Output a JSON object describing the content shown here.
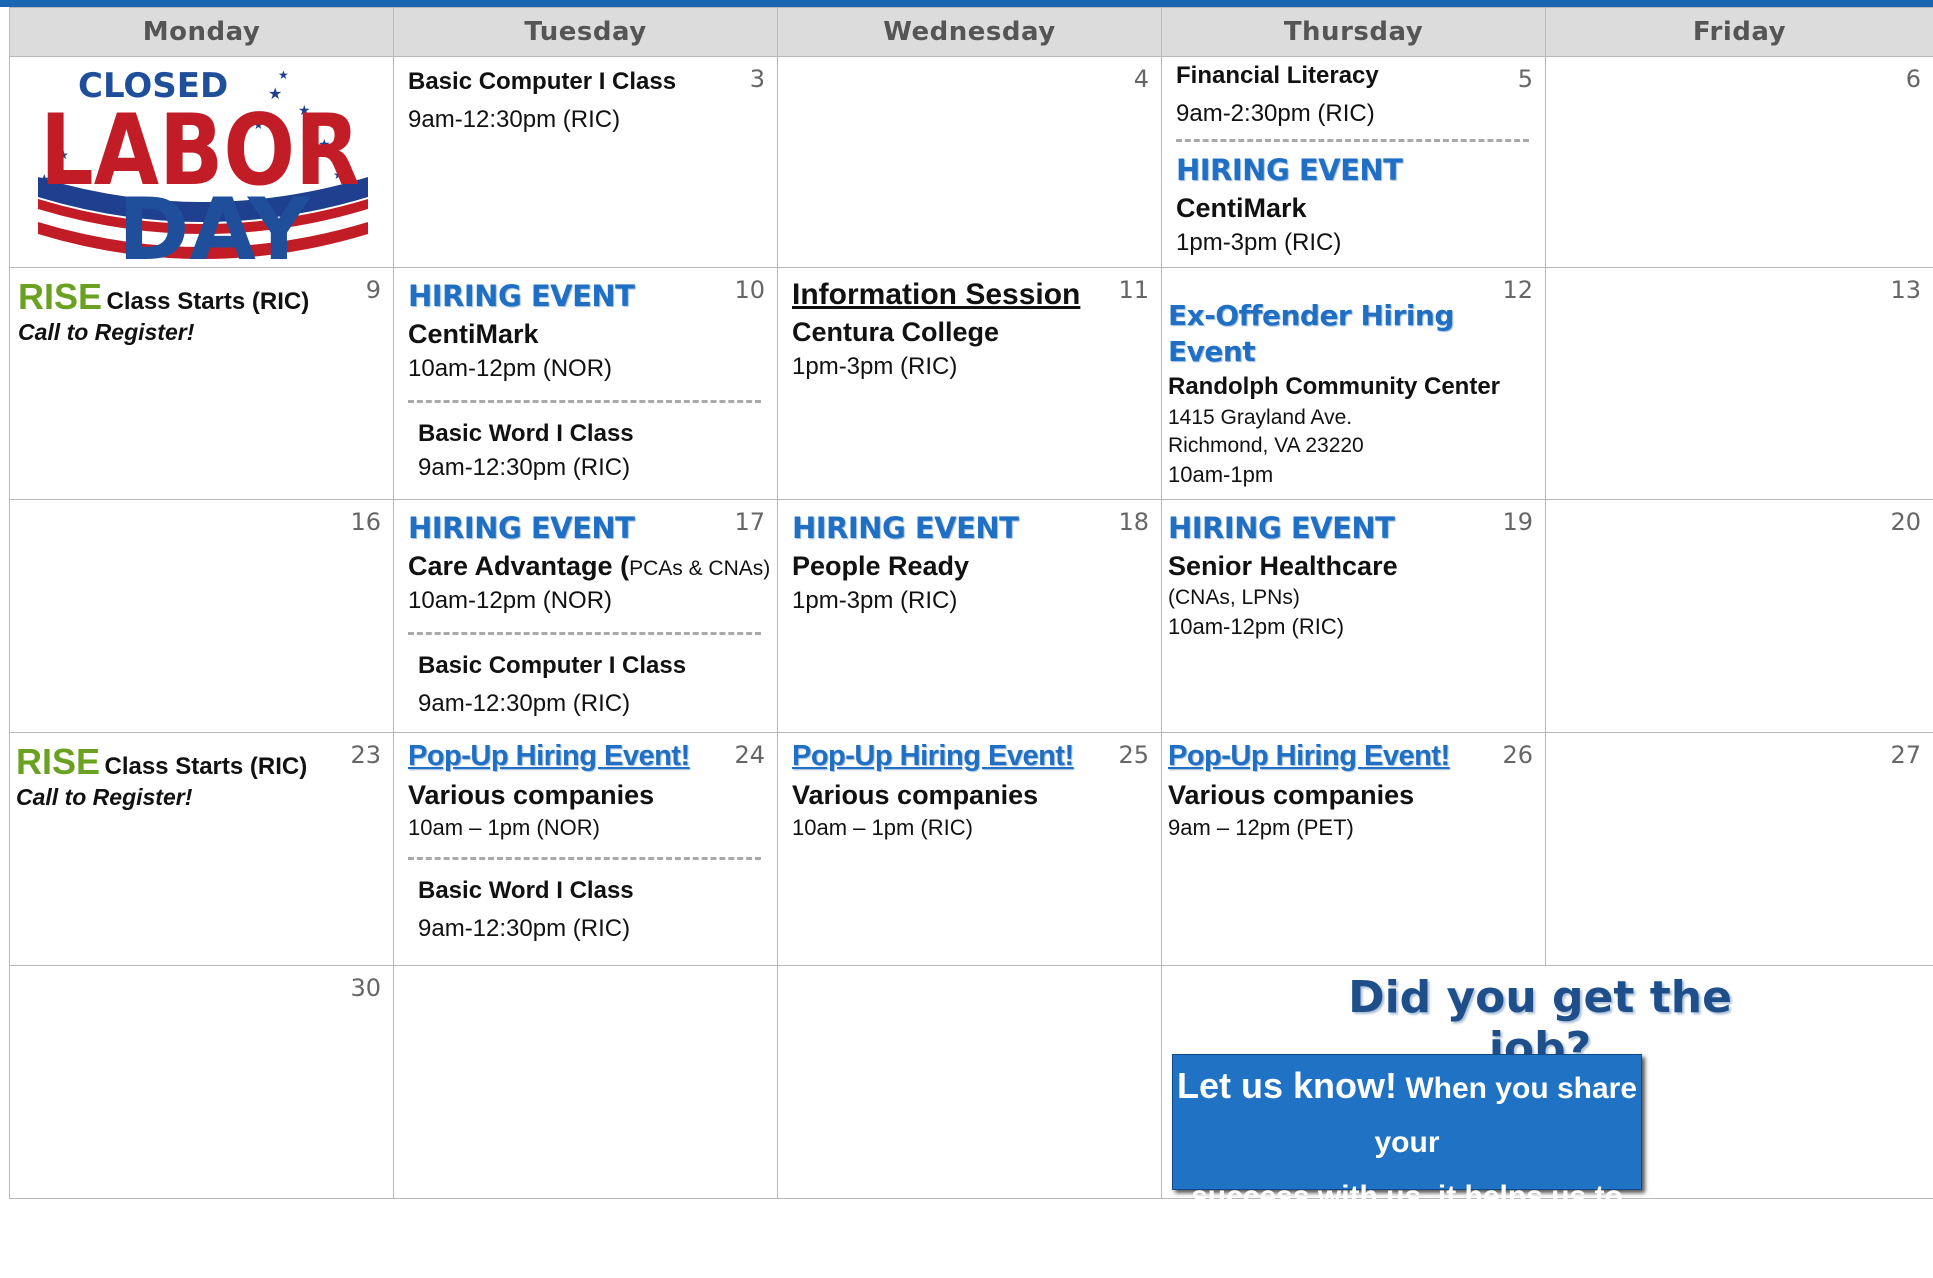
{
  "headers": [
    "Monday",
    "Tuesday",
    "Wednesday",
    "Thursday",
    "Friday"
  ],
  "week1": {
    "mon_logo": {
      "closed": "CLOSED",
      "labor": "LABOR",
      "day": "DAY"
    },
    "tue": {
      "day": "3",
      "title": "Basic Computer I Class",
      "time": "9am-12:30pm (RIC)"
    },
    "wed": {
      "day": "4"
    },
    "thu": {
      "day": "5",
      "title": "Financial Literacy",
      "time": "9am-2:30pm (RIC)",
      "event": "HIRING EVENT",
      "company": "CentiMark",
      "time2": "1pm-3pm (RIC)"
    },
    "fri": {
      "day": "6"
    }
  },
  "week2": {
    "mon": {
      "day": "9",
      "rise": "RISE",
      "title": "Class Starts (RIC)",
      "note": "Call to Register!"
    },
    "tue": {
      "day": "10",
      "event": "HIRING EVENT",
      "company": "CentiMark",
      "time": "10am-12pm (NOR)",
      "title2": "Basic Word I Class",
      "time2": "9am-12:30pm (RIC)"
    },
    "wed": {
      "day": "11",
      "title": "Information Session",
      "company": "Centura College",
      "time": "1pm-3pm (RIC)"
    },
    "thu": {
      "day": "12",
      "event": "Ex-Offender Hiring Event",
      "place": "Randolph Community Center",
      "addr1": "1415 Grayland Ave.",
      "addr2": "Richmond, VA  23220",
      "time": "10am-1pm"
    },
    "fri": {
      "day": "13"
    }
  },
  "week3": {
    "mon": {
      "day": "16"
    },
    "tue": {
      "day": "17",
      "event": "HIRING EVENT",
      "company": "Care Advantage (",
      "company_small": "PCAs & CNAs)",
      "time": "10am-12pm (NOR)",
      "title2": "Basic Computer I Class",
      "time2": "9am-12:30pm (RIC)"
    },
    "wed": {
      "day": "18",
      "event": "HIRING EVENT",
      "company": "People Ready",
      "time": "1pm-3pm (RIC)"
    },
    "thu": {
      "day": "19",
      "event": "HIRING EVENT",
      "company": "Senior Healthcare",
      "roles": "(CNAs, LPNs)",
      "time": "10am-12pm (RIC)"
    },
    "fri": {
      "day": "20"
    }
  },
  "week4": {
    "mon": {
      "day": "23",
      "rise": "RISE",
      "title": "Class Starts (RIC)",
      "note": "Call to Register!"
    },
    "tue": {
      "day": "24",
      "event": "Pop-Up Hiring Event!",
      "company": "Various companies",
      "time": "10am – 1pm (NOR)",
      "title2": "Basic Word I Class",
      "time2": "9am-12:30pm (RIC)"
    },
    "wed": {
      "day": "25",
      "event": "Pop-Up Hiring Event!",
      "company": "Various companies",
      "time": "10am – 1pm (RIC)"
    },
    "thu": {
      "day": "26",
      "event": "Pop-Up Hiring Event!",
      "company": "Various companies",
      "time": "9am – 12pm (PET)"
    },
    "fri": {
      "day": "27"
    }
  },
  "week5": {
    "mon": {
      "day": "30"
    }
  },
  "promo": {
    "question": "Did you get the job?",
    "line1_big": "Let us know!",
    "line1_rest": " When you share your",
    "line2": "success with us, it helps us to help others."
  }
}
